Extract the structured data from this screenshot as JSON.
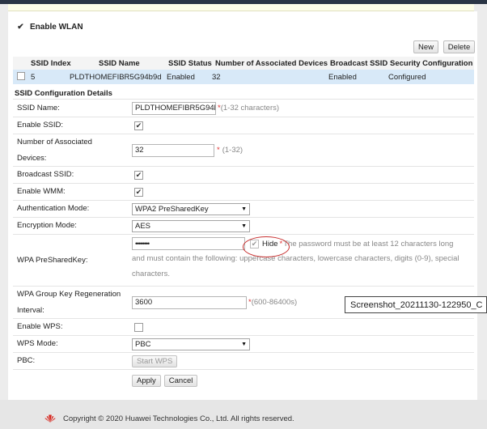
{
  "enable_wlan": {
    "label": "Enable WLAN",
    "checked": true
  },
  "toolbar": {
    "new_label": "New",
    "delete_label": "Delete"
  },
  "ssid_table": {
    "headers": [
      "SSID Index",
      "SSID Name",
      "SSID Status",
      "Number of Associated Devices",
      "Broadcast SSID",
      "Security Configuration"
    ],
    "rows": [
      {
        "index": "5",
        "name": "PLDTHOMEFIBR5G94b9d",
        "status": "Enabled",
        "associated": "32",
        "broadcast": "Enabled",
        "security": "Configured"
      }
    ]
  },
  "details": {
    "title": "SSID Configuration Details",
    "ssid_name": {
      "label": "SSID Name:",
      "value": "PLDTHOMEFIBR5G94b",
      "hint": "(1-32 characters)"
    },
    "enable_ssid": {
      "label": "Enable SSID:",
      "checked": true
    },
    "num_devices": {
      "label_line1": "Number of Associated",
      "label_line2": "Devices:",
      "value": "32",
      "hint": "(1-32)"
    },
    "broadcast_ssid": {
      "label": "Broadcast SSID:",
      "checked": true
    },
    "enable_wmm": {
      "label": "Enable WMM:",
      "checked": true
    },
    "auth_mode": {
      "label": "Authentication Mode:",
      "value": "WPA2 PreSharedKey"
    },
    "encryption_mode": {
      "label": "Encryption Mode:",
      "value": "AES"
    },
    "psk": {
      "label": "WPA PreSharedKey:",
      "value": "••••••••",
      "hide_label": "Hide",
      "hint_line1": "The password must be at least 12 characters long",
      "hint_line2": "and must contain the following: uppercase characters, lowercase characters, digits (0-9), special",
      "hint_line3": "characters."
    },
    "group_key": {
      "label_line1": "WPA Group Key Regeneration",
      "label_line2": "Interval:",
      "value": "3600",
      "hint": "(600-86400s)"
    },
    "enable_wps": {
      "label": "Enable WPS:",
      "checked": false
    },
    "wps_mode": {
      "label": "WPS Mode:",
      "value": "PBC"
    },
    "pbc": {
      "label": "PBC:",
      "button": "Start WPS"
    }
  },
  "actions": {
    "apply": "Apply",
    "cancel": "Cancel"
  },
  "footer": {
    "copyright": "Copyright © 2020 Huawei Technologies Co., Ltd. All rights reserved."
  },
  "tooltip": {
    "text": "Screenshot_20211130-122950_C"
  },
  "colors": {
    "selected_row": "#d8e9f8",
    "required": "#e03030",
    "annotation": "#c83030",
    "logo": "#d7261e"
  }
}
